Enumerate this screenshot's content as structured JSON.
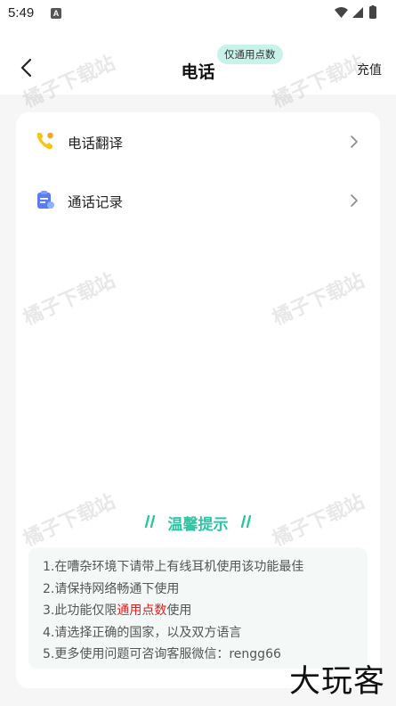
{
  "status_bar": {
    "time": "5:49",
    "notification_icon_label": "A"
  },
  "header": {
    "title": "电话",
    "badge": "仅通用点数",
    "recharge": "充值"
  },
  "menu": [
    {
      "label": "电话翻译",
      "icon": "phone-icon"
    },
    {
      "label": "通话记录",
      "icon": "call-record-icon"
    }
  ],
  "tips": {
    "title": "温馨提示",
    "items": [
      "1.在嘈杂环境下请带上有线耳机使用该功能最佳",
      "2.请保持网络畅通下使用",
      "4.请选择正确的国家，以及双方语言",
      "5.更多使用问题可咨询客服微信：rengg66"
    ],
    "item3_prefix": "3.此功能仅限",
    "item3_highlight": "通用点数",
    "item3_suffix": "使用"
  },
  "watermark": "橘子下载站",
  "corner_brand": "大玩客",
  "colors": {
    "accent": "#2fc4a4",
    "highlight": "#e11d1d",
    "badge_bg": "#c9f3ea"
  }
}
